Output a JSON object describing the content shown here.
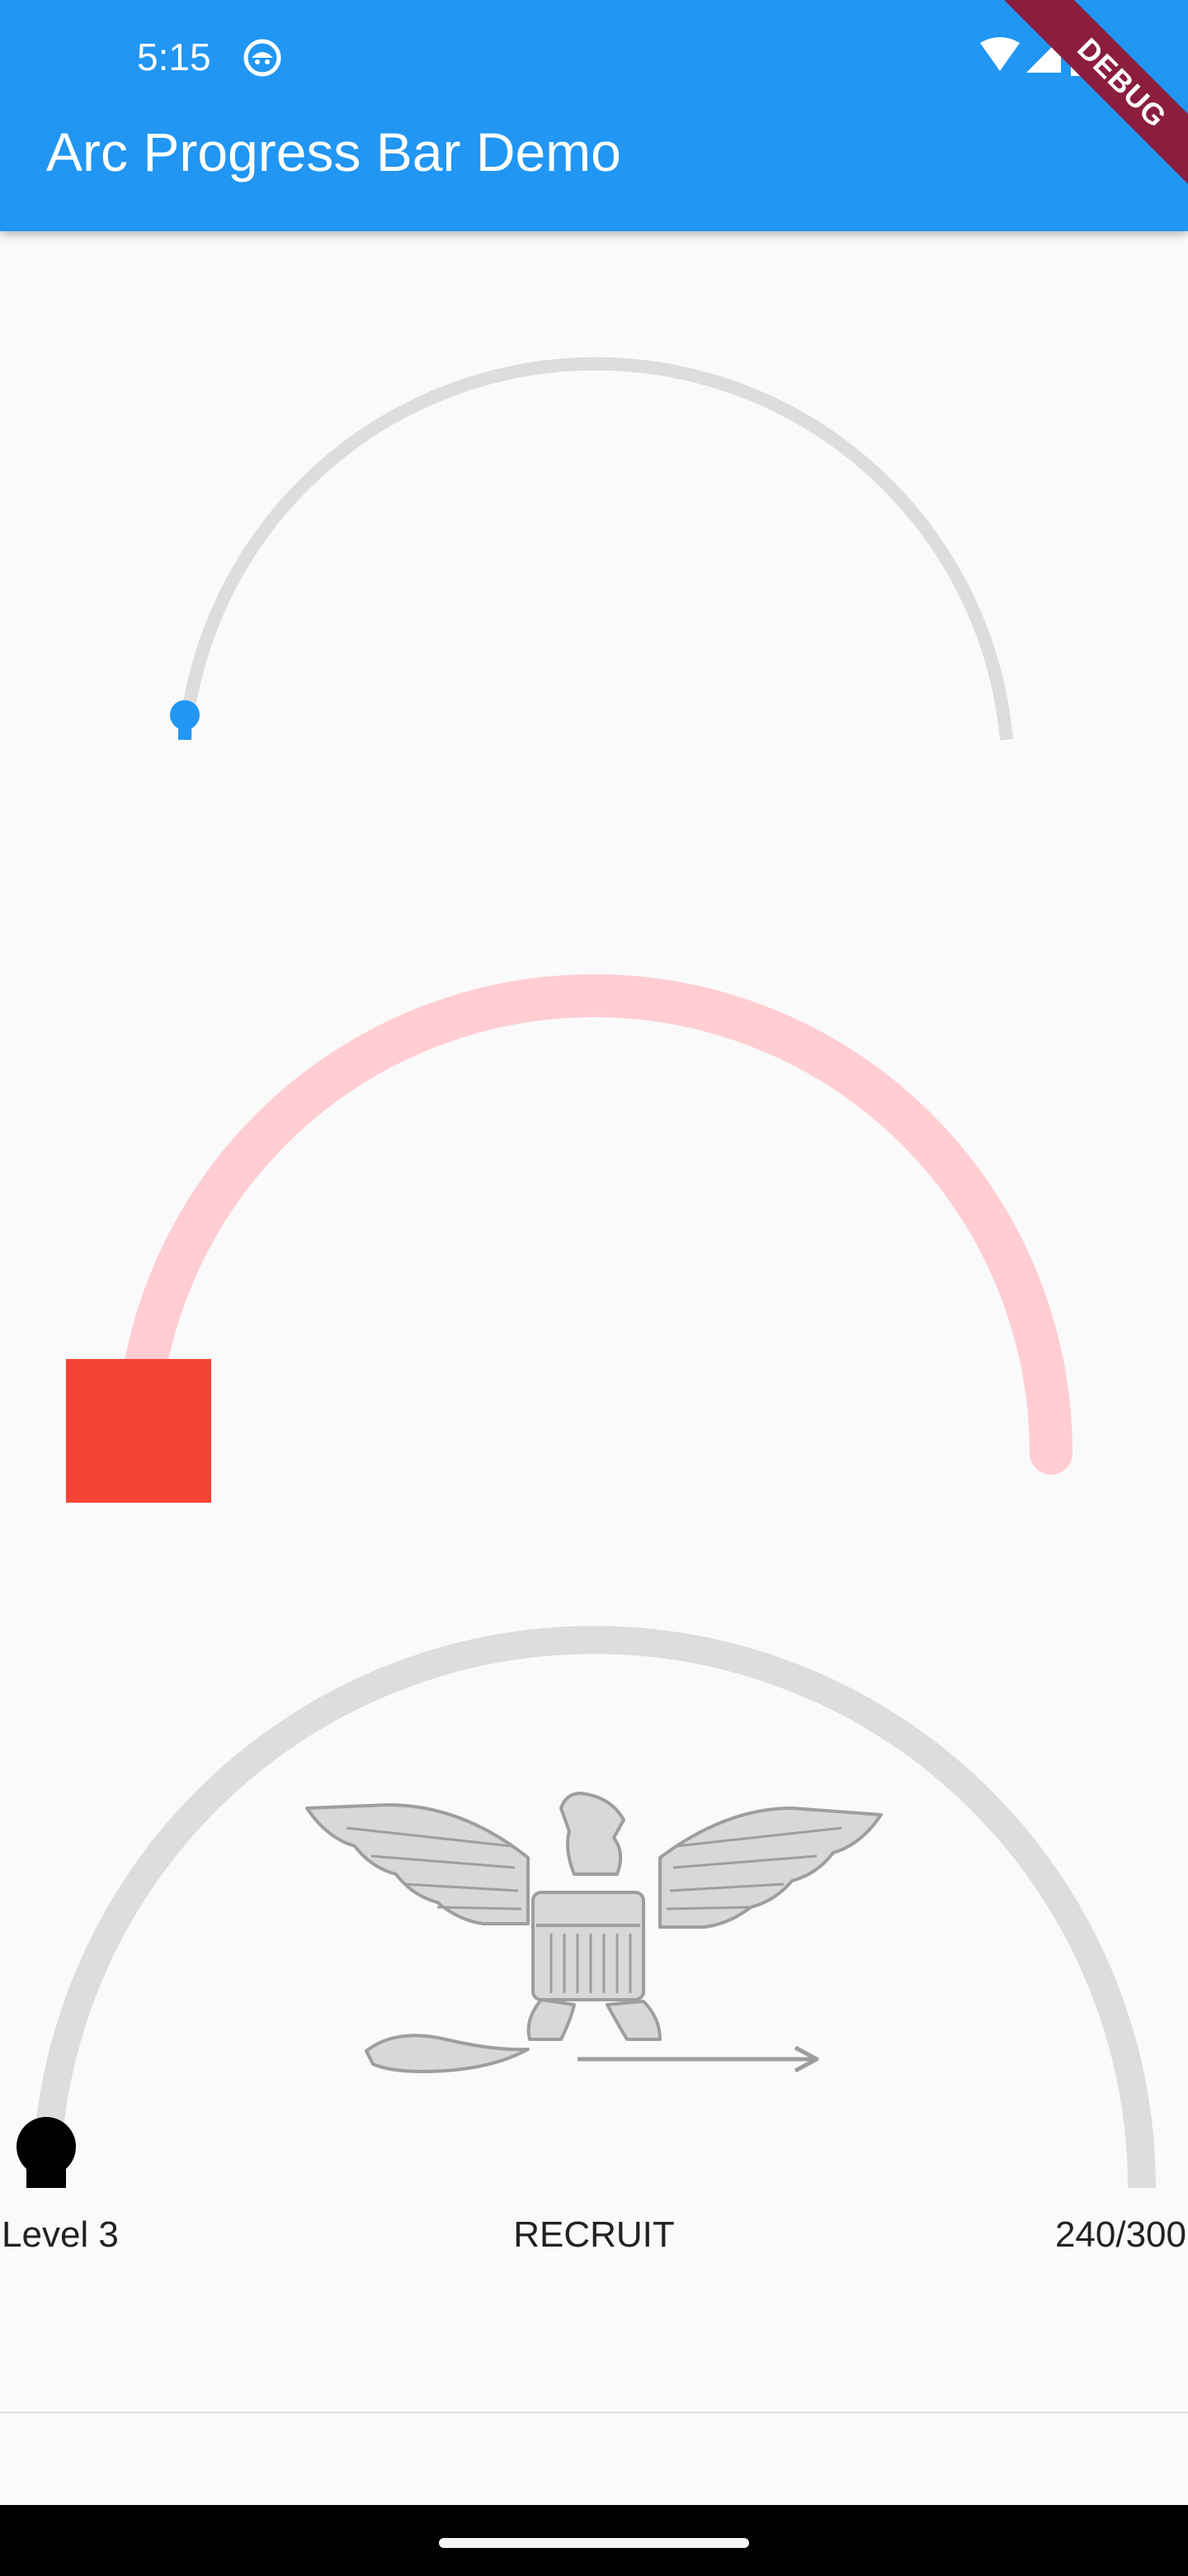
{
  "status_bar": {
    "time": "5:15",
    "icons": [
      "app-notification-icon",
      "wifi-icon",
      "cellular-signal-icon",
      "battery-icon"
    ]
  },
  "app_bar": {
    "title": "Arc Progress Bar Demo",
    "background_color": "#2196f3",
    "debug_banner": "DEBUG",
    "debug_banner_color": "#8b1e3f"
  },
  "arc_1": {
    "progress": 0,
    "track_color": "#dddddd",
    "handle_color": "#2196f3",
    "handle_icon": "location-pin-icon"
  },
  "arc_2": {
    "progress": 0,
    "track_color": "#ffcdd2",
    "handle_color": "#f44336",
    "handle_icon": "square-handle-icon"
  },
  "arc_3": {
    "progress": 0,
    "track_color": "#dddddd",
    "handle_color": "#000000",
    "handle_icon": "location-pin-icon",
    "center_image": "eagle-insignia-icon",
    "bottom_left_text": "Level 3",
    "bottom_center_text": "RECRUIT",
    "bottom_right_text": "240/300"
  },
  "nav_bar": {
    "icons": [
      "home-gesture-handle"
    ]
  }
}
